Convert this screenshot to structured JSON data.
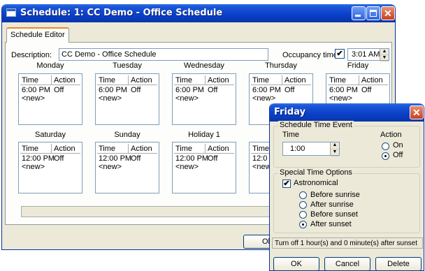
{
  "main_window": {
    "title": "Schedule: 1: CC Demo - Office Schedule",
    "tab_label": "Schedule Editor",
    "description_label": "Description:",
    "description_value": "CC Demo - Office Schedule",
    "occupancy_label": "Occupancy time:",
    "occupancy_checked": "✔",
    "occupancy_value": "3:01 AM",
    "col_time": "Time",
    "col_action": "Action",
    "days": [
      {
        "name": "Monday",
        "time": "6:00 PM",
        "action": "Off",
        "new": "<new>"
      },
      {
        "name": "Tuesday",
        "time": "6:00 PM",
        "action": "Off",
        "new": "<new>"
      },
      {
        "name": "Wednesday",
        "time": "6:00 PM",
        "action": "Off",
        "new": "<new>"
      },
      {
        "name": "Thursday",
        "time": "6:00 PM",
        "action": "Off",
        "new": "<new>"
      },
      {
        "name": "Friday",
        "time": "6:00 PM",
        "action": "Off",
        "new": "<new>"
      },
      {
        "name": "Saturday",
        "time": "12:00 PM",
        "action": "Off",
        "new": "<new>"
      },
      {
        "name": "Sunday",
        "time": "12:00 PM",
        "action": "Off",
        "new": "<new>"
      },
      {
        "name": "Holiday 1",
        "time": "12:00 PM",
        "action": "Off",
        "new": "<new>"
      },
      {
        "name": "H",
        "time": "12:0",
        "action": "",
        "new": "<new>"
      }
    ],
    "ok_partial": "Ol"
  },
  "dialog": {
    "title": "Friday",
    "event_group": "Schedule Time Event",
    "time_label": "Time",
    "time_value": "1:00",
    "action_label": "Action",
    "on_label": "On",
    "off_label": "Off",
    "special_group": "Special Time Options",
    "astronomical_label": "Astronomical",
    "astronomical_check": "✔",
    "options": [
      "Before sunrise",
      "After sunrise",
      "Before sunset",
      "After sunset"
    ],
    "status": "Turn off 1 hour(s) and 0 minute(s) after sunset",
    "ok": "OK",
    "cancel": "Cancel",
    "delete": "Delete"
  }
}
